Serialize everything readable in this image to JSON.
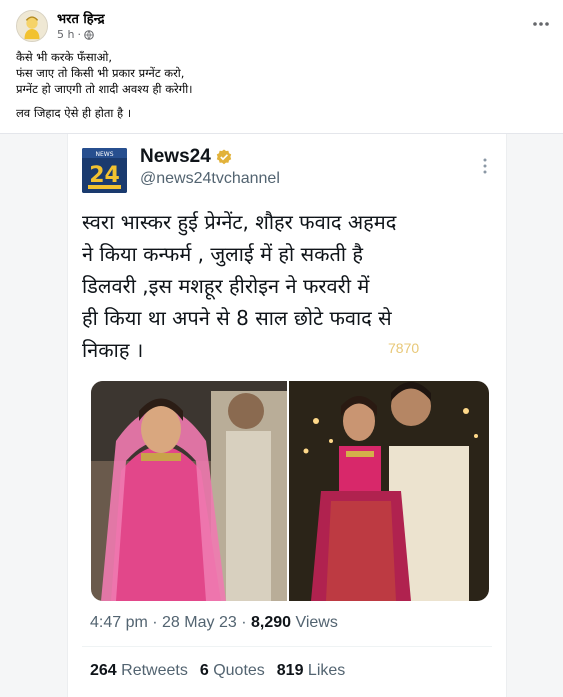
{
  "post": {
    "author": "भरत हिन्द्र",
    "time": "5 h",
    "dot": "·",
    "caption_lines": [
      "कैसे भी करके फँसाओ,",
      "फंस जाए तो किसी भी प्रकार प्रग्नेंट करो,",
      "प्रग्नेंट हो जाएगी तो शादी अवश्य ही करेगी।",
      "लव जिहाद ऐसे ही होता है ।"
    ]
  },
  "tweet": {
    "logo_text": "24",
    "logo_small": "NEWS",
    "name": "News24",
    "handle": "@news24tvchannel",
    "text_lines": [
      "स्वरा भास्कर हुई प्रेग्नेंट, शौहर फवाद अहमद",
      "ने किया कन्फर्म , जुलाई में हो सकती है",
      "डिलवरी ,इस मशहूर हीरोइन ने फरवरी में",
      "ही किया था अपने से 8 साल छोटे फवाद से",
      "निकाह ।"
    ],
    "watermark": "7870",
    "timestamp": "4:47 pm · 28 May 23 · ",
    "views_count": "8,290",
    "views_label": " Views",
    "retweets_count": "264",
    "retweets_label": " Retweets",
    "quotes_count": "6",
    "quotes_label": " Quotes",
    "likes_count": "819",
    "likes_label": " Likes"
  },
  "colors": {
    "verified_badge": "#e2b23a",
    "logo_bg": "#1a3a6e",
    "logo_accent": "#f2c230"
  },
  "icons": {
    "more": "more-horizontal-icon",
    "globe": "globe-icon",
    "badge": "verified-badge-icon",
    "tweet_more": "more-vertical-icon"
  }
}
